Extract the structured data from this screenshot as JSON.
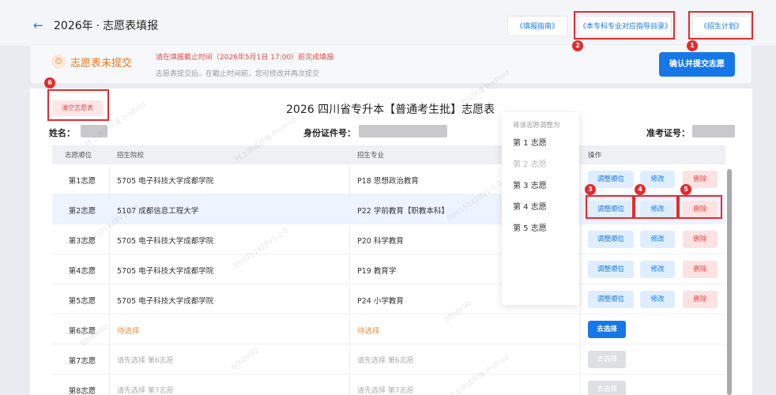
{
  "header": {
    "year": "2026年",
    "sep": "·",
    "title": "志愿表填报",
    "links": [
      {
        "label": "《填报指南》"
      },
      {
        "label": "《本专科专业对应指导目录》"
      },
      {
        "label": "《招生计划》"
      }
    ]
  },
  "notice": {
    "status": "志愿表未提交",
    "main": "请在填报截止时间（2026年5月1日 17:00）前完成填报",
    "sub": "志愿表提交后，在截止时间前，您可修改并再次提交",
    "submit_label": "确认并提交志愿"
  },
  "form": {
    "clear_label": "清空志愿表",
    "title": "2026 四川省专升本【普通考生批】志愿表",
    "name_label": "姓名：",
    "id_label": "身份证件号：",
    "exam_label": "准考证号："
  },
  "table": {
    "headers": [
      "志愿顺位",
      "招生院校",
      "招生专业",
      "操作"
    ],
    "rows": [
      {
        "order": "第1志愿",
        "school": "5705 电子科技大学成都学院",
        "major": "P18 思想政治教育",
        "state": "filled"
      },
      {
        "order": "第2志愿",
        "school": "5107 成都信息工程大学",
        "major": "P22 学前教育【职教本科】",
        "state": "filled"
      },
      {
        "order": "第3志愿",
        "school": "5705 电子科技大学成都学院",
        "major": "P20 科学教育",
        "state": "filled"
      },
      {
        "order": "第4志愿",
        "school": "5705 电子科技大学成都学院",
        "major": "P19 教育学",
        "state": "filled"
      },
      {
        "order": "第5志愿",
        "school": "5705 电子科技大学成都学院",
        "major": "P24 小学教育",
        "state": "filled"
      },
      {
        "order": "第6志愿",
        "school": "待选择",
        "major": "待选择",
        "state": "pending"
      },
      {
        "order": "第7志愿",
        "school": "请先选择 第6志愿",
        "major": "请先选择 第6志愿",
        "state": "locked"
      },
      {
        "order": "第8志愿",
        "school": "请先选择 第7志愿",
        "major": "请先选择 第7志愿",
        "state": "locked"
      }
    ],
    "actions": {
      "adjust": "调整顺位",
      "edit": "修改",
      "delete": "删除",
      "choose": "去选择"
    }
  },
  "dropdown": {
    "title": "将该志愿调整为",
    "items": [
      "第 1 志愿",
      "第 2 志愿",
      "第 3 志愿",
      "第 4 志愿",
      "第 5 志愿"
    ],
    "disabled_index": 1
  },
  "annotations": [
    "1",
    "2",
    "3",
    "4",
    "5",
    "6"
  ],
  "watermark": [
    "线上测试环境 PreProd",
    "D0415142BV1.0.0",
    "88b8e90"
  ],
  "colors": {
    "accent": "#1677e8",
    "danger": "#e24b4b",
    "warning": "#e9781f",
    "annotation": "#e42c2c"
  }
}
